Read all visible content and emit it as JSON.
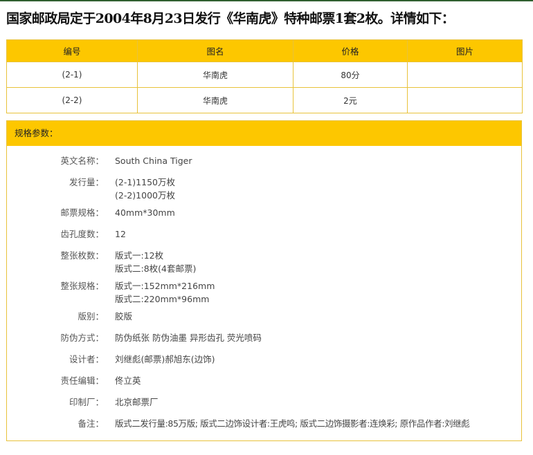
{
  "heading": "国家邮政局定于2004年8月23日发行《华南虎》特种邮票1套2枚。详情如下：",
  "stamps_table": {
    "headers": [
      "编号",
      "图名",
      "价格",
      "图片"
    ],
    "rows": [
      {
        "number": "(2-1)",
        "name": "华南虎",
        "price": "80分",
        "image": ""
      },
      {
        "number": "(2-2)",
        "name": "华南虎",
        "price": "2元",
        "image": ""
      }
    ]
  },
  "specs": {
    "title": "规格参数：",
    "items": [
      {
        "label": "英文名称：",
        "values": [
          "South China Tiger"
        ]
      },
      {
        "label": "发行量：",
        "values": [
          "(2-1)1150万枚",
          "(2-2)1000万枚"
        ]
      },
      {
        "label": "邮票规格：",
        "values": [
          "40mm*30mm"
        ]
      },
      {
        "label": "齿孔度数：",
        "values": [
          "12"
        ]
      },
      {
        "label": "整张枚数：",
        "values": [
          "版式一:12枚",
          "版式二:8枚(4套邮票)"
        ]
      },
      {
        "label": "整张规格：",
        "values": [
          "版式一:152mm*216mm",
          "版式二:220mm*96mm"
        ]
      },
      {
        "label": "版别：",
        "values": [
          "胶版"
        ]
      },
      {
        "label": "防伪方式：",
        "values": [
          "防伪纸张 防伪油墨 异形齿孔 荧光喷码"
        ]
      },
      {
        "label": "设计者：",
        "values": [
          "刘继彪(邮票)郝旭东(边饰)"
        ]
      },
      {
        "label": "责任编辑：",
        "values": [
          "佟立英"
        ]
      },
      {
        "label": "印制厂：",
        "values": [
          "北京邮票厂"
        ]
      },
      {
        "label": "备注：",
        "values": [
          "版式二发行量:85万版; 版式二边饰设计者:王虎鸣; 版式二边饰摄影者:连焕彩; 原作品作者:刘继彪"
        ]
      }
    ]
  }
}
